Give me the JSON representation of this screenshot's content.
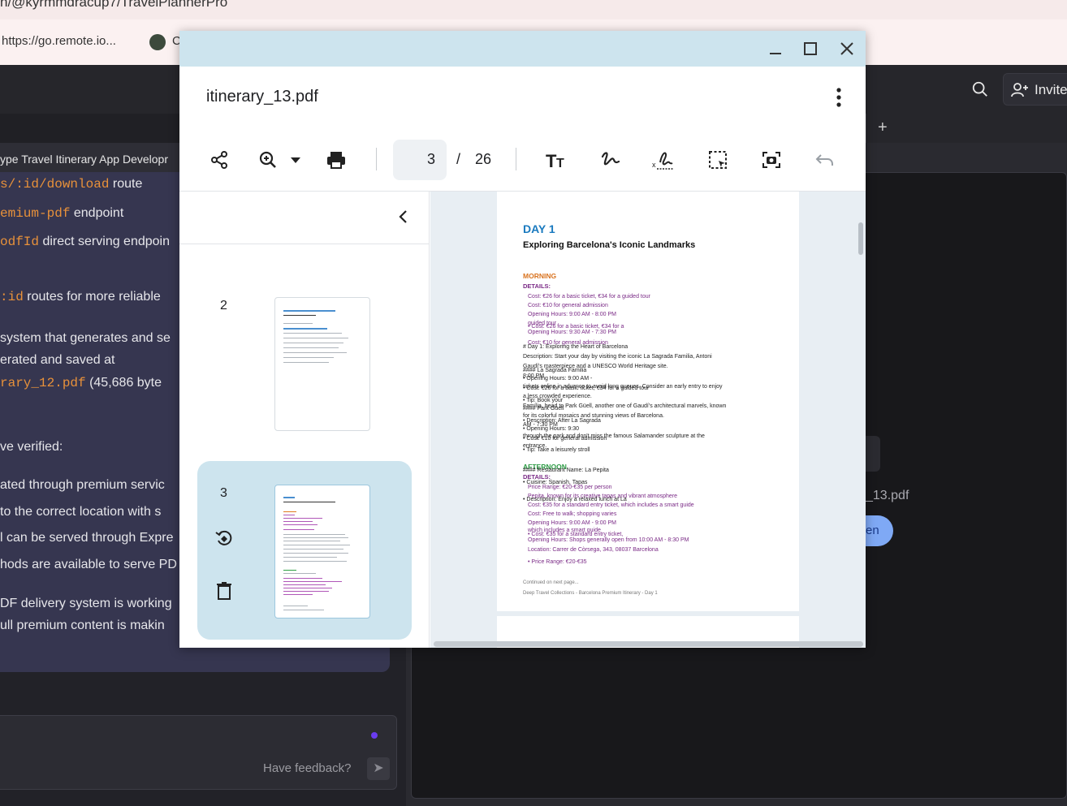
{
  "browser": {
    "url_text": "n/@kyrmmdracup7/TravelPlannerPro",
    "bookmarks": [
      "https://go.remote.io...",
      "C"
    ]
  },
  "app": {
    "invite_label": "Invite",
    "left_title": "ype Travel Itinerary App Developr",
    "chat": [
      {
        "code": "s/:id/download",
        "text": " route"
      },
      {
        "code": "emium-pdf",
        "text": " endpoint"
      },
      {
        "code": "odfId",
        "text": " direct serving endpoin"
      },
      {
        "code": ":id",
        "text": " routes for more reliable"
      },
      {
        "code": "",
        "text": "system that generates and se"
      },
      {
        "code": "",
        "text": "erated and saved at"
      },
      {
        "code": "rary_12.pdf",
        "text": " (45,686 byte"
      },
      {
        "code": "",
        "text": "ve verified:"
      },
      {
        "code": "",
        "text": "ated through premium servic"
      },
      {
        "code": "",
        "text": "to the correct location with s"
      },
      {
        "code": "",
        "text": "l can be served through Expre"
      },
      {
        "code": "",
        "text": "hods are available to serve PD"
      },
      {
        "code": "",
        "text": "DF delivery system is working"
      },
      {
        "code": "",
        "text": "ull premium content is makin"
      }
    ],
    "feedback_label": "Have feedback?",
    "right_file_name": "_13.pdf",
    "open_label": "en"
  },
  "pdf_viewer": {
    "file_name": "itinerary_13.pdf",
    "current_page": "3",
    "page_sep": "/",
    "total_pages": "26",
    "thumbnails": [
      {
        "num": "2",
        "selected": false
      },
      {
        "num": "3",
        "selected": true
      }
    ],
    "page": {
      "day": "DAY 1",
      "subtitle": "Exploring Barcelona's Iconic Landmarks",
      "morning": "MORNING",
      "details": "DETAILS:",
      "morning_items": [
        "Cost: €26 for a basic ticket, €34 for a guided tour",
        "Cost: €10 for general admission",
        "Opening Hours: 9:00 AM - 8:00 PM",
        "guided tour",
        "• Cost: €26 for a basic ticket, €34 for a",
        "Opening Hours: 9:30 AM - 7:30 PM",
        "Cost: €10 for general admission"
      ],
      "md_lines": [
        "# Day 1: Exploring the Heart of Barcelona",
        "Description: Start your day by visiting the iconic La Sagrada Familia, Antoni",
        "Gaudí's masterpiece and a UNESCO World Heritage site.",
        "#### La Sagrada Familia",
        "8:00 PM",
        "• Opening Hours: 9:00 AM -",
        "tickets online in advance to avoid long queues. Consider an early entry to enjoy",
        "• Cost: €26 for a basic ticket, €34 for a guided tour",
        "a less crowded experience.",
        "• Tip: Book your",
        "Família, head to Park Güell, another one of Gaudí's architectural marvels, known",
        "#### Park Güell",
        "for its colorful mosaics and stunning views of Barcelona.",
        "• Description: After La Sagrada",
        "AM - 7:30 PM",
        "• Opening Hours: 9:30",
        "through the park and don't miss the famous Salamander sculpture at the",
        "• Cost: €10 for general admission",
        "entrance.",
        "• Tip: Take a leisurely stroll"
      ],
      "afternoon": "AFTERNOON",
      "afternoon_md": [
        "#### Restaurant Name: La Pepita",
        "• Cuisine: Spanish, Tapas",
        "• Description: Enjoy a relaxed lunch at La"
      ],
      "afternoon_details": "DETAILS:",
      "afternoon_items": [
        "Price Range: €20-€35 per person",
        "Pepita, known for its creative tapas and vibrant atmosphere",
        "Cost: €35 for a standard entry ticket, which includes a smart guide",
        "Cost: Free to walk; shopping varies",
        "Opening Hours: 9:00 AM - 9:00 PM",
        "Opening Hours: Shops generally open from 10:00 AM - 8:30 PM",
        "Location: Carrer de Còrsega, 343, 08037 Barcelona",
        "• Price Range: €20-€35"
      ],
      "overlap_lines": [
        "which includes a smart guide",
        "• Cost: €35 for a standard entry ticket,"
      ],
      "continued": "Continued on next page...",
      "footer": "Deep Travel Collections - Barcelona Premium Itinerary - Day 1"
    }
  }
}
